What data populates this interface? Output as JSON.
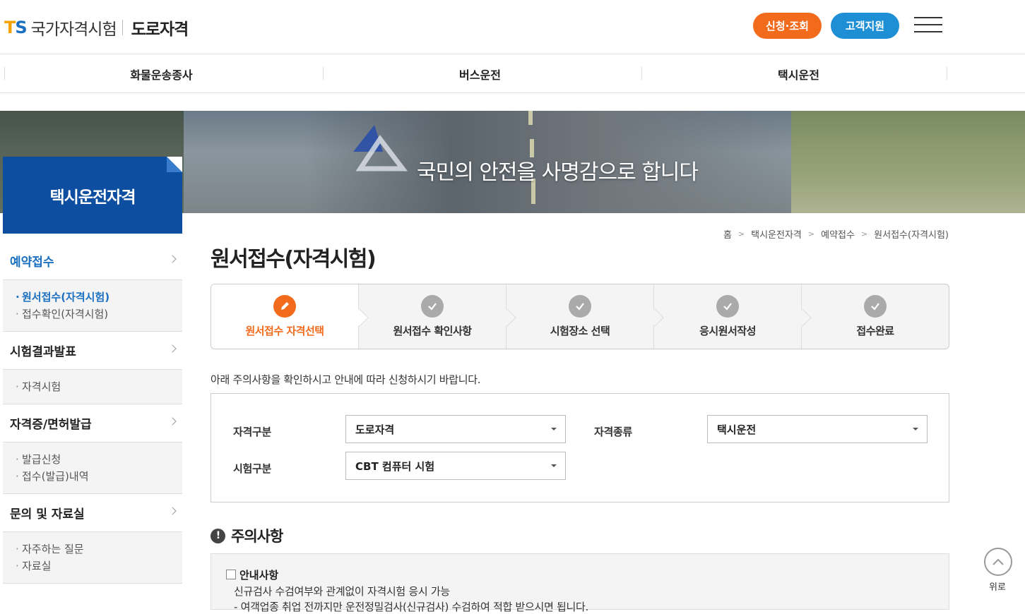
{
  "header": {
    "logo_ts": "TS",
    "logo_text": "국가자격시험",
    "logo_sub": "도로자격",
    "apply_button": "신청·조회",
    "support_button": "고객지원",
    "menu_icon": "hamburger-icon"
  },
  "gnb": [
    "화물운송종사",
    "버스운전",
    "택시운전"
  ],
  "banner": {
    "slogan": "국민의 안전을 사명감으로 합니다"
  },
  "sidebar": {
    "title": "택시운전자격",
    "groups": [
      {
        "label": "예약접수",
        "active": true,
        "items": [
          "원서접수(자격시험)",
          "접수확인(자격시험)"
        ]
      },
      {
        "label": "시험결과발표",
        "active": false,
        "items": [
          "자격시험"
        ]
      },
      {
        "label": "자격증/면허발급",
        "active": false,
        "items": [
          "발급신청",
          "접수(발급)내역"
        ]
      },
      {
        "label": "문의 및 자료실",
        "active": false,
        "items": [
          "자주하는 질문",
          "자료실"
        ]
      }
    ]
  },
  "breadcrumb": [
    "홈",
    "택시운전자격",
    "예약접수",
    "원서접수(자격시험)"
  ],
  "page_title": "원서접수(자격시험)",
  "steps": [
    {
      "label": "원서접수 자격선택",
      "icon": "pencil-icon",
      "active": true
    },
    {
      "label": "원서접수 확인사항",
      "icon": "check-icon",
      "active": false
    },
    {
      "label": "시험장소 선택",
      "icon": "check-icon",
      "active": false
    },
    {
      "label": "응시원서작성",
      "icon": "check-icon",
      "active": false
    },
    {
      "label": "접수완료",
      "icon": "check-icon",
      "active": false
    }
  ],
  "guide_text": "아래 주의사항을 확인하시고 안내에 따라 신청하시기 바랍니다.",
  "form": {
    "category_label": "자격구분",
    "category_value": "도로자격",
    "type_label": "자격종류",
    "type_value": "택시운전",
    "exam_label": "시험구분",
    "exam_value": "CBT 컴퓨터 시험"
  },
  "notice": {
    "title": "주의사항",
    "head": "안내사항",
    "line1": "신규검사 수검여부와 관계없이 자격시험 응시 가능",
    "line2": "- 여객업종 취업 전까지만 운전정밀검사(신규검사) 수검하여 적합 받으시면 됩니다."
  },
  "top_button": {
    "label": "위로",
    "icon": "chevron-up-icon"
  },
  "colors": {
    "orange": "#f26b1d",
    "blue": "#1f8fd5",
    "navy": "#0d4ea0",
    "active_text": "#1a6fc0"
  }
}
